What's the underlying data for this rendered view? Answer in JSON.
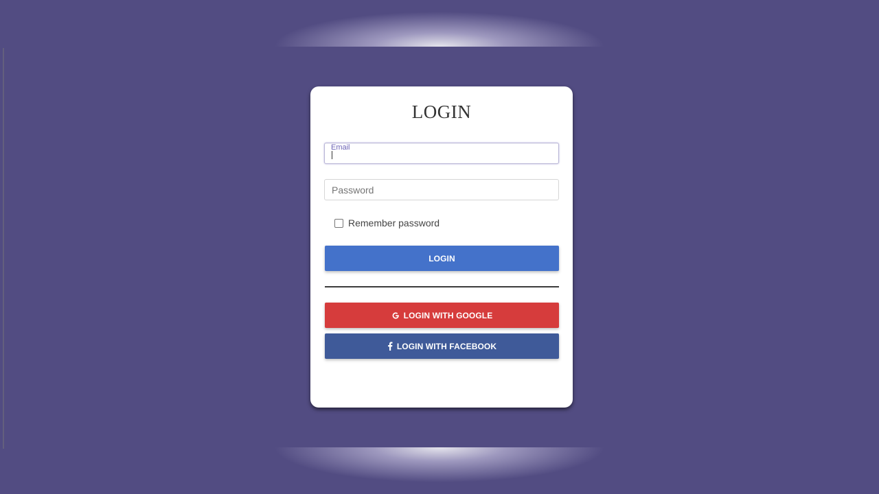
{
  "login_card": {
    "title": "LOGIN",
    "email_field": {
      "label": "Email",
      "value": ""
    },
    "password_field": {
      "placeholder": "Password",
      "value": ""
    },
    "remember_label": "Remember password",
    "remember_checked": false,
    "login_button": "LOGIN",
    "google_button": "LOGIN WITH GOOGLE",
    "facebook_button": "LOGIN WITH FACEBOOK"
  },
  "icons": {
    "google": "google-icon",
    "facebook": "facebook-icon"
  },
  "colors": {
    "background": "#524c82",
    "login_button": "#4472ca",
    "google_button": "#d63c3c",
    "facebook_button": "#3f5a99",
    "card": "#ffffff"
  }
}
